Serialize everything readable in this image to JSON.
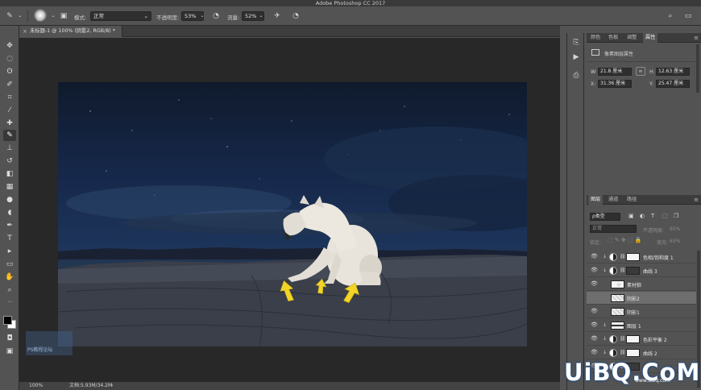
{
  "app": {
    "title": "Adobe Photoshop CC 2017"
  },
  "options": {
    "brush_size": "60",
    "mode_label": "模式:",
    "mode_value": "正常",
    "opacity_label": "不透明度:",
    "opacity_value": "53%",
    "flow_label": "流量:",
    "flow_value": "52%"
  },
  "document": {
    "tab_title": "未标题-1 @ 100% (阴影2, RGB/8) *"
  },
  "status": {
    "zoom": "100%",
    "doc_size": "文档:5.93M/34.2M"
  },
  "properties_panel": {
    "tabs": [
      "颜色",
      "色板",
      "调整",
      "属性"
    ],
    "active_tab": "属性",
    "section_title": "像素图层属性",
    "w_label": "W:",
    "w_value": "21.8 厘米",
    "h_label": "H:",
    "h_value": "12.63 厘米",
    "x_label": "X:",
    "x_value": "31.36 厘米",
    "y_label": "Y:",
    "y_value": "25.47 厘米"
  },
  "layers_panel": {
    "tabs": [
      "图层",
      "通道",
      "路径"
    ],
    "active_tab": "图层",
    "filter_label": "ρ类型",
    "blend_mode": "正常",
    "opacity_label": "不透明度:",
    "opacity_value": "65%",
    "lock_label": "锁定:",
    "fill_label": "填充:",
    "fill_value": "65%",
    "layers": [
      {
        "name": "色相/饱和度 1",
        "kind": "adjust-white",
        "clip": true,
        "visible": true,
        "selected": false
      },
      {
        "name": "曲线 3",
        "kind": "adjust-mask-dark",
        "clip": true,
        "visible": true,
        "selected": false
      },
      {
        "name": "素材狼",
        "kind": "pixel-wolf",
        "clip": false,
        "visible": true,
        "selected": false
      },
      {
        "name": "阴影2",
        "kind": "pixel-check",
        "clip": false,
        "visible": false,
        "selected": true
      },
      {
        "name": "阴影1",
        "kind": "pixel-check",
        "clip": false,
        "visible": true,
        "selected": false
      },
      {
        "name": "图层 1",
        "kind": "pixel-strip",
        "clip": true,
        "visible": true,
        "selected": false
      },
      {
        "name": "色彩平衡 2",
        "kind": "adjust-white",
        "clip": true,
        "visible": true,
        "selected": false
      },
      {
        "name": "曲线 2",
        "kind": "adjust-white",
        "clip": true,
        "visible": true,
        "selected": false
      },
      {
        "name": "",
        "kind": "adjust-dark",
        "clip": false,
        "visible": true,
        "selected": false
      }
    ]
  },
  "watermark": {
    "text": "UiBQ.CoM",
    "sub": "www.uibq.com",
    "left_logo": "PS教程论坛"
  },
  "colors": {
    "accent_arrow": "#f2d327",
    "sky_top": "#0f1a2c",
    "selection": "#6e6e6e"
  }
}
